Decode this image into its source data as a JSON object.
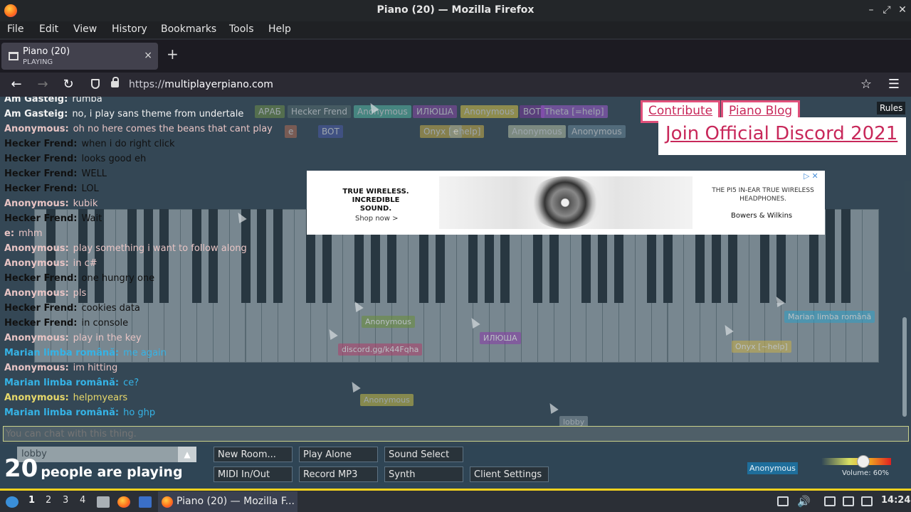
{
  "window": {
    "title": "Piano (20) — Mozilla Firefox"
  },
  "menubar": {
    "items": [
      "File",
      "Edit",
      "View",
      "History",
      "Bookmarks",
      "Tools",
      "Help"
    ]
  },
  "tab": {
    "title": "Piano (20)",
    "status": "PLAYING",
    "new_tab": "+",
    "close": "×"
  },
  "navbar": {
    "url_prefix": "https://",
    "url_domain": "multiplayerpiano.com"
  },
  "room_users": [
    {
      "name": "АРАБ",
      "color": "#6f8e4a"
    },
    {
      "name": "Hecker Frend",
      "color": "#546a6e"
    },
    {
      "name": "Anonymous",
      "color": "#56b8a4"
    },
    {
      "name": "ИЛЮША",
      "color": "#8a4aa8"
    },
    {
      "name": "Anonymous",
      "color": "#d8c64a"
    },
    {
      "name": "BOT",
      "color": "#7a3a9c"
    },
    {
      "name": "Theta [=help]",
      "color": "#a05bd0"
    },
    {
      "name": "e",
      "color": "#b06c54"
    },
    {
      "name": "BOT",
      "color": "#4a5aa8"
    },
    {
      "name": "Onyx [~help]",
      "color": "#c9b04a"
    },
    {
      "name": "e",
      "color": "#8a9a9f"
    },
    {
      "name": "Anonymous",
      "color": "#b7c2a6"
    },
    {
      "name": "Anonymous",
      "color": "#6b8a9b"
    },
    {
      "name": "Marian limba română",
      "color": "#3aa5c8"
    }
  ],
  "chat": [
    {
      "name": "Am Gasteig:",
      "text": "rumba",
      "color": "#f2f2f2"
    },
    {
      "name": "Am Gasteig:",
      "text": "no, i play sans theme from undertale",
      "color": "#f2f2f2"
    },
    {
      "name": "Anonymous:",
      "text": "oh no here comes the beans that cant play",
      "color": "#e8c4c4"
    },
    {
      "name": "Hecker Frend:",
      "text": "when i do right click",
      "color": "#111111"
    },
    {
      "name": "Hecker Frend:",
      "text": "looks good eh",
      "color": "#111111"
    },
    {
      "name": "Hecker Frend:",
      "text": "WELL",
      "color": "#111111"
    },
    {
      "name": "Hecker Frend:",
      "text": "LOL",
      "color": "#111111"
    },
    {
      "name": "Anonymous:",
      "text": "kubik",
      "color": "#e8c4c4"
    },
    {
      "name": "Hecker Frend:",
      "text": "Wait",
      "color": "#111111"
    },
    {
      "name": "e:",
      "text": "mhm",
      "color": "#e8c4c4"
    },
    {
      "name": "Anonymous:",
      "text": "play something i want to follow along",
      "color": "#e8c4c4"
    },
    {
      "name": "Anonymous:",
      "text": "in c#",
      "color": "#e8c4c4"
    },
    {
      "name": "Hecker Frend:",
      "text": "one hungry one",
      "color": "#111111"
    },
    {
      "name": "Anonymous:",
      "text": "pls",
      "color": "#e8c4c4"
    },
    {
      "name": "Hecker Frend:",
      "text": "cookies data",
      "color": "#111111"
    },
    {
      "name": "Hecker Frend:",
      "text": "in console",
      "color": "#111111"
    },
    {
      "name": "Anonymous:",
      "text": "play in the key",
      "color": "#e8c4c4"
    },
    {
      "name": "Marian limba română:",
      "text": "me again",
      "color": "#35b3e6"
    },
    {
      "name": "Anonymous:",
      "text": "im hitting",
      "color": "#e8c4c4"
    },
    {
      "name": "Marian limba română:",
      "text": "ce?",
      "color": "#35b3e6"
    },
    {
      "name": "Anonymous:",
      "text": "helpmyears",
      "color": "#e7d86a"
    },
    {
      "name": "Marian limba română:",
      "text": "ho ghp",
      "color": "#35b3e6"
    }
  ],
  "chat_input": {
    "placeholder": "You can chat with this thing."
  },
  "promo": {
    "contribute": "Contribute",
    "blog": "Piano Blog",
    "discord": "Join Official Discord 2021",
    "rules": "Rules"
  },
  "ad": {
    "headline": "TRUE WIRELESS. INCREDIBLE SOUND.",
    "cta": "Shop now >",
    "product": "THE PI5 IN-EAR TRUE WIRELESS HEADPHONES.",
    "brand": "Bowers & Wilkins",
    "close": "▷✕"
  },
  "cursor_tags": [
    {
      "label": "Anonymous",
      "color": "#6a8f3a"
    },
    {
      "label": "discord.gg/k44Fqha",
      "color": "#b0406a"
    },
    {
      "label": "ИЛЮША",
      "color": "#8a3aa8"
    },
    {
      "label": "Anonymous",
      "color": "#c9c04a"
    },
    {
      "label": "Marian limba română",
      "color": "#2fa0c8"
    },
    {
      "label": "Onyx [~help]",
      "color": "#c9b04a"
    },
    {
      "label": "lobby",
      "color": "#8a9aa3"
    }
  ],
  "bottom": {
    "room": "lobby",
    "count": "20",
    "count_label": "people are playing",
    "buttons": [
      "New Room...",
      "Play Alone",
      "Sound Select",
      "MIDI In/Out",
      "Record MP3",
      "Synth",
      "Client Settings"
    ],
    "user_badge": "Anonymous",
    "volume_label": "Volume: 60%",
    "volume_level": 0.6
  },
  "taskbar": {
    "workspaces": [
      "1",
      "2",
      "3",
      "4"
    ],
    "app_title": "Piano (20) — Mozilla F...",
    "clock": "14:24"
  }
}
